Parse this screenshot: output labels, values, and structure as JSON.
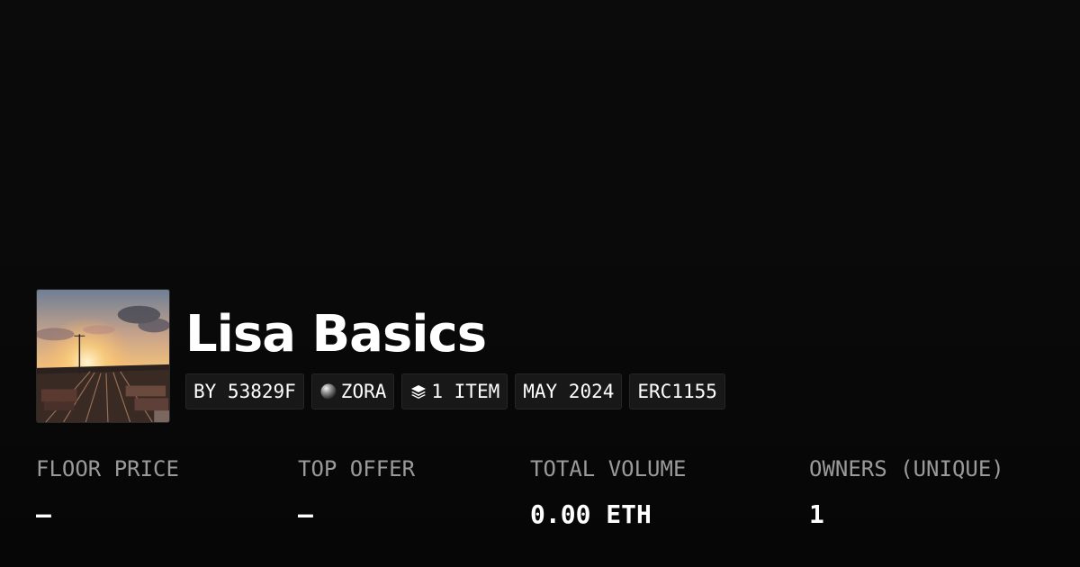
{
  "collection": {
    "title": "Lisa Basics",
    "thumbnail_icon": "railyard-sunset-thumbnail"
  },
  "badges": {
    "creator": "BY 53829F",
    "chain": "ZORA",
    "chain_icon": "zora-orb-icon",
    "items": "1 ITEM",
    "items_icon": "layers-icon",
    "date": "MAY 2024",
    "standard": "ERC1155"
  },
  "stats": [
    {
      "label": "FLOOR PRICE",
      "value": "—"
    },
    {
      "label": "TOP OFFER",
      "value": "—"
    },
    {
      "label": "TOTAL VOLUME",
      "value": "0.00 ETH"
    },
    {
      "label": "OWNERS (UNIQUE)",
      "value": "1"
    }
  ]
}
